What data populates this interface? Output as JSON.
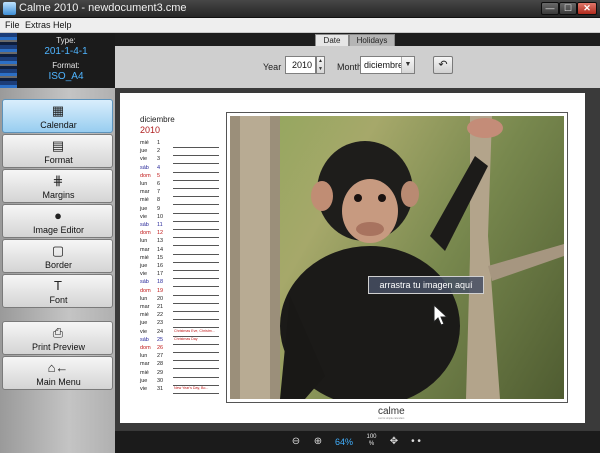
{
  "window": {
    "title": "Calme 2010 - newdocument3.cme",
    "min": "—",
    "max": "☐",
    "close": "✕"
  },
  "menu": {
    "items": [
      "File",
      "Extras",
      "Help"
    ]
  },
  "info": {
    "type_label": "Type:",
    "type_value": "201-1-4-1",
    "format_label": "Format:",
    "format_value": "ISO_A4"
  },
  "sidebar": {
    "items": [
      {
        "label": "Calendar",
        "icon": "calendar-icon",
        "glyph": "▦",
        "active": true
      },
      {
        "label": "Format",
        "icon": "format-icon",
        "glyph": "▤",
        "active": false
      },
      {
        "label": "Margins",
        "icon": "margins-icon",
        "glyph": "⋕",
        "active": false
      },
      {
        "label": "Image Editor",
        "icon": "person-icon",
        "glyph": "●",
        "active": false
      },
      {
        "label": "Border",
        "icon": "border-icon",
        "glyph": "▢",
        "active": false
      },
      {
        "label": "Font",
        "icon": "font-icon",
        "glyph": "T",
        "active": false
      },
      {
        "label": "Print Preview",
        "icon": "print-preview-icon",
        "glyph": "⎙",
        "active": false
      },
      {
        "label": "Main Menu",
        "icon": "home-back-icon",
        "glyph": "⌂←",
        "active": false
      }
    ]
  },
  "toolbar": {
    "tabs": [
      "Date",
      "Holidays"
    ],
    "active_tab": "Date",
    "year_label": "Year",
    "year_value": "2010",
    "month_label": "Month",
    "month_value": "diciembre",
    "spin_up": "▲",
    "spin_down": "▼",
    "dropdown_arrow": "▼",
    "reset_glyph": "↶"
  },
  "calendar": {
    "month": "diciembre",
    "year": "2010",
    "days": [
      {
        "wd": "mié",
        "d": "1"
      },
      {
        "wd": "jue",
        "d": "2"
      },
      {
        "wd": "vie",
        "d": "3"
      },
      {
        "wd": "sáb",
        "d": "4",
        "kind": "sat"
      },
      {
        "wd": "dom",
        "d": "5",
        "kind": "sun"
      },
      {
        "wd": "lun",
        "d": "6"
      },
      {
        "wd": "mar",
        "d": "7"
      },
      {
        "wd": "mié",
        "d": "8"
      },
      {
        "wd": "jue",
        "d": "9"
      },
      {
        "wd": "vie",
        "d": "10"
      },
      {
        "wd": "sáb",
        "d": "11",
        "kind": "sat"
      },
      {
        "wd": "dom",
        "d": "12",
        "kind": "sun"
      },
      {
        "wd": "lun",
        "d": "13"
      },
      {
        "wd": "mar",
        "d": "14"
      },
      {
        "wd": "mié",
        "d": "15"
      },
      {
        "wd": "jue",
        "d": "16"
      },
      {
        "wd": "vie",
        "d": "17"
      },
      {
        "wd": "sáb",
        "d": "18",
        "kind": "sat"
      },
      {
        "wd": "dom",
        "d": "19",
        "kind": "sun"
      },
      {
        "wd": "lun",
        "d": "20"
      },
      {
        "wd": "mar",
        "d": "21"
      },
      {
        "wd": "mié",
        "d": "22"
      },
      {
        "wd": "jue",
        "d": "23"
      },
      {
        "wd": "vie",
        "d": "24",
        "note": "Christmas Eve, Christm..."
      },
      {
        "wd": "sáb",
        "d": "25",
        "kind": "sat",
        "note": "Christmas Day"
      },
      {
        "wd": "dom",
        "d": "26",
        "kind": "sun"
      },
      {
        "wd": "lun",
        "d": "27"
      },
      {
        "wd": "mar",
        "d": "28"
      },
      {
        "wd": "mié",
        "d": "29"
      },
      {
        "wd": "jue",
        "d": "30"
      },
      {
        "wd": "vie",
        "d": "31",
        "note": "New Year's Day, Bo..."
      }
    ]
  },
  "image": {
    "drop_hint": "arrastra tu imagen aquí"
  },
  "brand": {
    "name": "calme",
    "sub": "cool & simple calendars"
  },
  "bottombar": {
    "zoom_out": "⊖",
    "zoom_in": "⊕",
    "zoom_value": "64%",
    "fit_top": "100",
    "fit_bottom": "%",
    "move": "✥",
    "more": "• •"
  },
  "colors": {
    "accent": "#41b0ff",
    "weekend": "#c01818",
    "active_nav": "#98cdf0"
  }
}
